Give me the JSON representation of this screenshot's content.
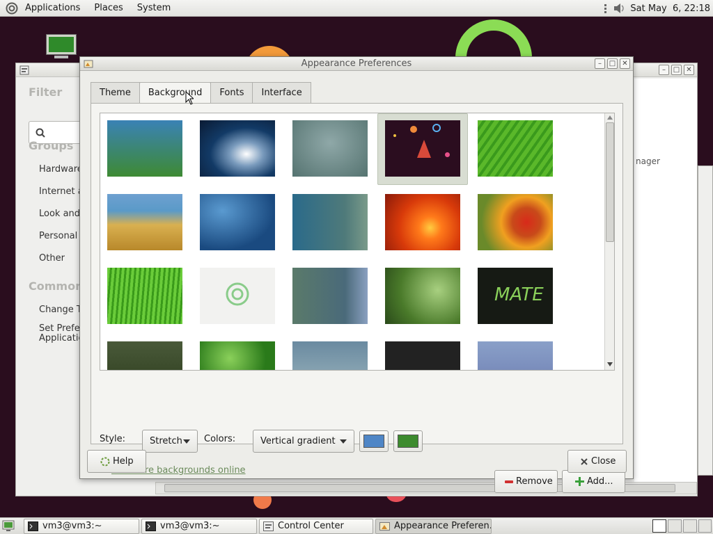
{
  "top_panel": {
    "menus": [
      "Applications",
      "Places",
      "System"
    ],
    "clock": "Sat May  6, 22:18"
  },
  "control_center": {
    "filter_heading": "Filter",
    "groups_heading": "Groups",
    "groups": [
      "Hardware",
      "Internet ar",
      "Look and",
      "Personal",
      "Other"
    ],
    "common_heading": "Common",
    "common": [
      "Change T",
      "Set Prefer",
      "Applicatio"
    ],
    "right_text": "nager"
  },
  "dialog": {
    "title": "Appearance Preferences",
    "tabs": [
      "Theme",
      "Background",
      "Fonts",
      "Interface"
    ],
    "active_tab": "Background",
    "style_label": "Style:",
    "style_value": "Stretch",
    "colors_label": "Colors:",
    "colors_value": "Vertical gradient",
    "primary_color": "#4f86c6",
    "secondary_color": "#3d8b2e",
    "more_link": "Get more backgrounds online",
    "remove_label": "Remove",
    "add_label": "Add...",
    "help_label": "Help",
    "close_label": "Close",
    "mate_thumb_text": "MATE",
    "selected_thumbnail_index": 3
  },
  "taskbar": {
    "tasks": [
      "vm3@vm3:~",
      "vm3@vm3:~",
      "Control Center",
      "Appearance Preferen..."
    ],
    "active_task_index": 3
  }
}
